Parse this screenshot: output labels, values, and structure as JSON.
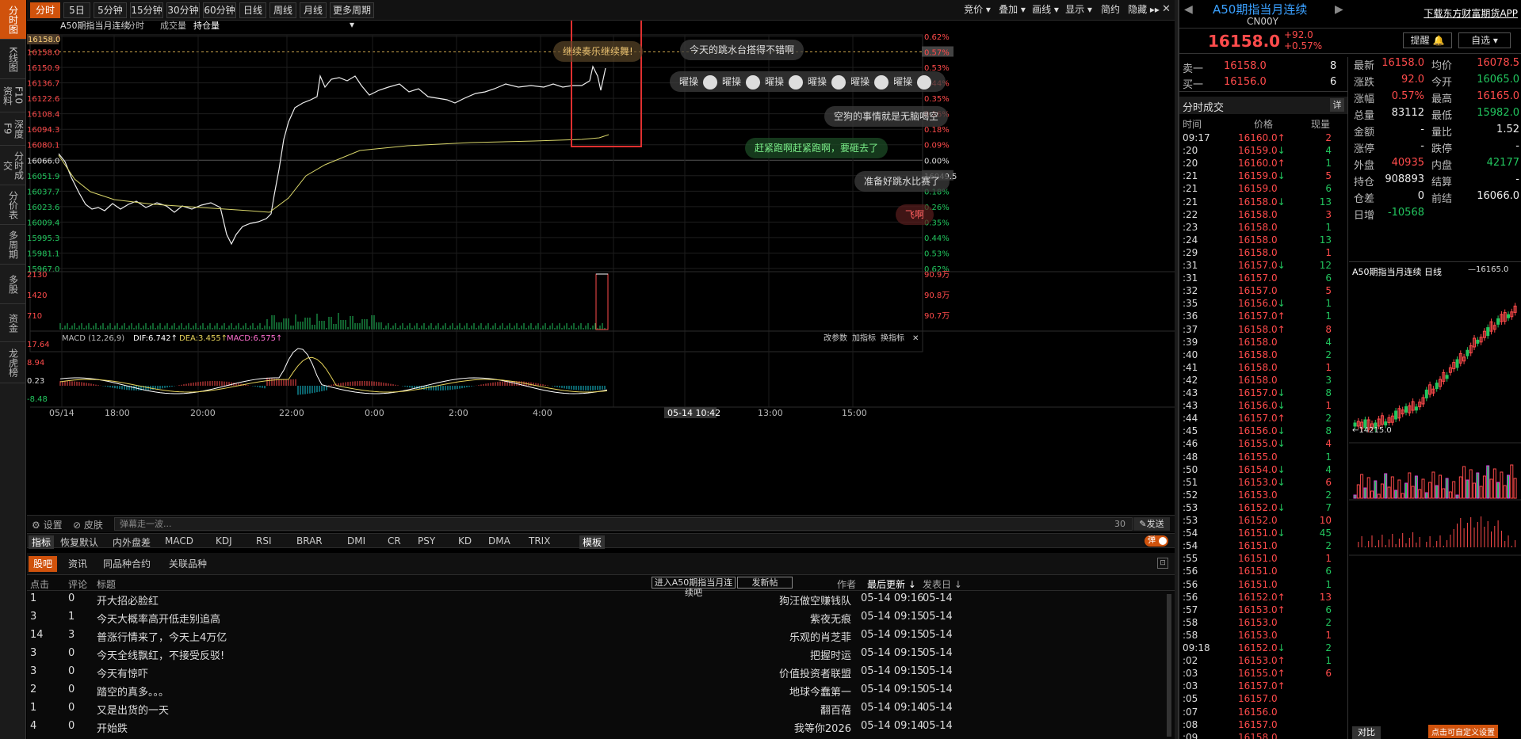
{
  "left_nav": [
    "分时图",
    "K线图",
    "F10资料",
    "深度F9",
    "分时成交",
    "分价表",
    "多周期",
    "多股",
    "资金",
    "龙虎榜"
  ],
  "toolbar": {
    "periods": [
      "分时",
      "5日",
      "5分钟",
      "15分钟",
      "30分钟",
      "60分钟",
      "日线",
      "周线",
      "月线",
      "更多周期"
    ],
    "right": [
      "竞价",
      "叠加",
      "画线",
      "显示",
      "简约",
      "隐藏"
    ]
  },
  "chart_header": {
    "name": "A50期指当月连续",
    "tabs": [
      "分时",
      "成交量",
      "持仓量"
    ]
  },
  "price_axis": [
    "16165.0",
    "16158.0",
    "16150.9",
    "16136.7",
    "16122.6",
    "16108.4",
    "16094.3",
    "16080.1",
    "16066.0",
    "16051.9",
    "16037.7",
    "16023.6",
    "16009.4",
    "15995.3",
    "15981.1",
    "15967.0"
  ],
  "pct_axis": [
    "0.62%",
    "0.57%",
    "0.53%",
    "0.44%",
    "0.35%",
    "0.26%",
    "0.18%",
    "0.09%",
    "0.00%",
    "16049.5",
    "0.18%",
    "0.26%",
    "0.35%",
    "0.44%",
    "0.53%",
    "0.62%"
  ],
  "volume_axis": [
    "2130",
    "1420",
    "710"
  ],
  "oi_axis": [
    "90.9万",
    "90.8万",
    "90.7万"
  ],
  "macd": {
    "label": "MACD (12,26,9)",
    "dif": "DIF:6.742",
    "dea": "DEA:3.455",
    "macd": "MACD:6.575",
    "axis": [
      "17.64",
      "8.94",
      "0.23",
      "-8.48"
    ],
    "actions": [
      "改参数",
      "加指标",
      "换指标"
    ]
  },
  "time_axis": [
    "05/14",
    "18:00",
    "20:00",
    "22:00",
    "0:00",
    "2:00",
    "4:00",
    "05-14 10:42",
    "13:00",
    "15:00"
  ],
  "danmaku": {
    "items": [
      "继续奏乐继续舞!",
      "今天的跳水台搭得不错啊",
      "曜操",
      "曜操",
      "曜操",
      "曜操",
      "曜操",
      "曜操",
      "空狗的事情就是无脑喝空",
      "赶紧跑啊赶紧跑啊，要砸去了",
      "准备好跳水比赛了",
      "飞啊"
    ],
    "settings": "设置",
    "skin": "皮肤",
    "placeholder": "弹幕走一波...",
    "count": "30",
    "send": "发送",
    "toggle": "弹"
  },
  "indicators": [
    "指标",
    "恢复默认",
    "内外盘差",
    "MACD",
    "KDJ",
    "RSI",
    "BRAR",
    "DMI",
    "CR",
    "PSY",
    "KD",
    "DMA",
    "TRIX",
    "模板"
  ],
  "news": {
    "tabs": [
      "股吧",
      "资讯",
      "同品种合约",
      "关联品种"
    ],
    "headers": {
      "clicks": "点击",
      "comments": "评论",
      "title": "标题",
      "author": "作者",
      "updated": "最后更新",
      "posted": "发表日"
    },
    "enter_button": "进入A50期指当月连续吧",
    "post_button": "发新帖",
    "rows": [
      {
        "clicks": "1",
        "comments": "0",
        "title": "开大招必脸红",
        "author": "狗汪做空赚钱队",
        "updated": "05-14  09:16",
        "posted": "05-14"
      },
      {
        "clicks": "3",
        "comments": "1",
        "title": "今天大概率高开低走别追高",
        "author": "紫夜无痕",
        "updated": "05-14  09:15",
        "posted": "05-14"
      },
      {
        "clicks": "14",
        "comments": "3",
        "title": "普涨行情来了，今天上4万亿",
        "author": "乐观的肖芝菲",
        "updated": "05-14  09:15",
        "posted": "05-14"
      },
      {
        "clicks": "3",
        "comments": "0",
        "title": "今天全线飘红，不接受反驳!",
        "author": "把握时运",
        "updated": "05-14  09:15",
        "posted": "05-14"
      },
      {
        "clicks": "3",
        "comments": "0",
        "title": "今天有惊吓",
        "author": "价值投资者联盟",
        "updated": "05-14  09:15",
        "posted": "05-14"
      },
      {
        "clicks": "2",
        "comments": "0",
        "title": "踏空的真多。。。",
        "author": "地球今蠢第一",
        "updated": "05-14  09:15",
        "posted": "05-14"
      },
      {
        "clicks": "1",
        "comments": "0",
        "title": "又是出货的一天",
        "author": "翻百蓓",
        "updated": "05-14  09:14",
        "posted": "05-14"
      },
      {
        "clicks": "4",
        "comments": "0",
        "title": "开始跌",
        "author": "我等你2026",
        "updated": "05-14  09:14",
        "posted": "05-14"
      }
    ]
  },
  "quote": {
    "name": "A50期指当月连续",
    "code": "CN00Y",
    "price": "16158.0",
    "change": "+92.0",
    "pct": "+0.57%",
    "download": "下载东方财富期货APP",
    "remind": "提醒",
    "watch": "自选",
    "ask_label": "卖一",
    "ask_price": "16158.0",
    "ask_vol": "8",
    "bid_label": "买一",
    "bid_price": "16156.0",
    "bid_vol": "6",
    "stats": [
      [
        "最新",
        "16158.0",
        "均价",
        "16078.5"
      ],
      [
        "涨跌",
        "92.0",
        "今开",
        "16065.0"
      ],
      [
        "涨幅",
        "0.57%",
        "最高",
        "16165.0"
      ],
      [
        "总量",
        "83112",
        "最低",
        "15982.0"
      ],
      [
        "金额",
        "-",
        "量比",
        "1.52"
      ],
      [
        "涨停",
        "-",
        "跌停",
        "-"
      ],
      [
        "外盘",
        "40935",
        "内盘",
        "42177"
      ],
      [
        "持仓",
        "908893",
        "结算",
        "-"
      ],
      [
        "仓差",
        "0",
        "前结",
        "16066.0"
      ],
      [
        "日增",
        "-10568",
        "",
        ""
      ]
    ]
  },
  "ticks": {
    "title": "分时成交",
    "detail": "详",
    "headers": [
      "时间",
      "价格",
      "现量"
    ],
    "rows": [
      [
        "09:17",
        "16160.0↑",
        "2"
      ],
      [
        ":20",
        "16159.0↓",
        "4"
      ],
      [
        ":20",
        "16160.0↑",
        "1"
      ],
      [
        ":21",
        "16159.0↓",
        "5"
      ],
      [
        ":21",
        "16159.0",
        "6"
      ],
      [
        ":21",
        "16158.0↓",
        "13"
      ],
      [
        ":22",
        "16158.0",
        "3"
      ],
      [
        ":23",
        "16158.0",
        "1"
      ],
      [
        ":24",
        "16158.0",
        "13"
      ],
      [
        ":29",
        "16158.0",
        "1"
      ],
      [
        ":31",
        "16157.0↓",
        "12"
      ],
      [
        ":31",
        "16157.0",
        "6"
      ],
      [
        ":32",
        "16157.0",
        "5"
      ],
      [
        ":35",
        "16156.0↓",
        "1"
      ],
      [
        ":36",
        "16157.0↑",
        "1"
      ],
      [
        ":37",
        "16158.0↑",
        "8"
      ],
      [
        ":39",
        "16158.0",
        "4"
      ],
      [
        ":40",
        "16158.0",
        "2"
      ],
      [
        ":41",
        "16158.0",
        "1"
      ],
      [
        ":42",
        "16158.0",
        "3"
      ],
      [
        ":43",
        "16157.0↓",
        "8"
      ],
      [
        ":43",
        "16156.0↓",
        "1"
      ],
      [
        ":44",
        "16157.0↑",
        "2"
      ],
      [
        ":45",
        "16156.0↓",
        "8"
      ],
      [
        ":46",
        "16155.0↓",
        "4"
      ],
      [
        ":48",
        "16155.0",
        "1"
      ],
      [
        ":50",
        "16154.0↓",
        "4"
      ],
      [
        ":51",
        "16153.0↓",
        "6"
      ],
      [
        ":52",
        "16153.0",
        "2"
      ],
      [
        ":53",
        "16152.0↓",
        "7"
      ],
      [
        ":53",
        "16152.0",
        "10"
      ],
      [
        ":54",
        "16151.0↓",
        "45"
      ],
      [
        ":54",
        "16151.0",
        "2"
      ],
      [
        ":55",
        "16151.0",
        "1"
      ],
      [
        ":56",
        "16151.0",
        "6"
      ],
      [
        ":56",
        "16151.0",
        "1"
      ],
      [
        ":56",
        "16152.0↑",
        "13"
      ],
      [
        ":57",
        "16153.0↑",
        "6"
      ],
      [
        ":58",
        "16153.0",
        "2"
      ],
      [
        ":58",
        "16153.0",
        "1"
      ],
      [
        "09:18",
        "16152.0↓",
        "2"
      ],
      [
        ":02",
        "16153.0↑",
        "1"
      ],
      [
        ":03",
        "16155.0↑",
        "6"
      ],
      [
        ":03",
        "16157.0↑",
        ""
      ],
      [
        ":05",
        "16157.0",
        ""
      ],
      [
        ":07",
        "16156.0",
        ""
      ],
      [
        ":08",
        "16157.0",
        ""
      ],
      [
        ":09",
        "16158.0",
        ""
      ]
    ]
  },
  "daily": {
    "title": "A50期指当月连续  日线",
    "high_label": "16165.0",
    "low_label": "14215.0",
    "tab": "对比",
    "overlay": "点击可自定义设置"
  }
}
